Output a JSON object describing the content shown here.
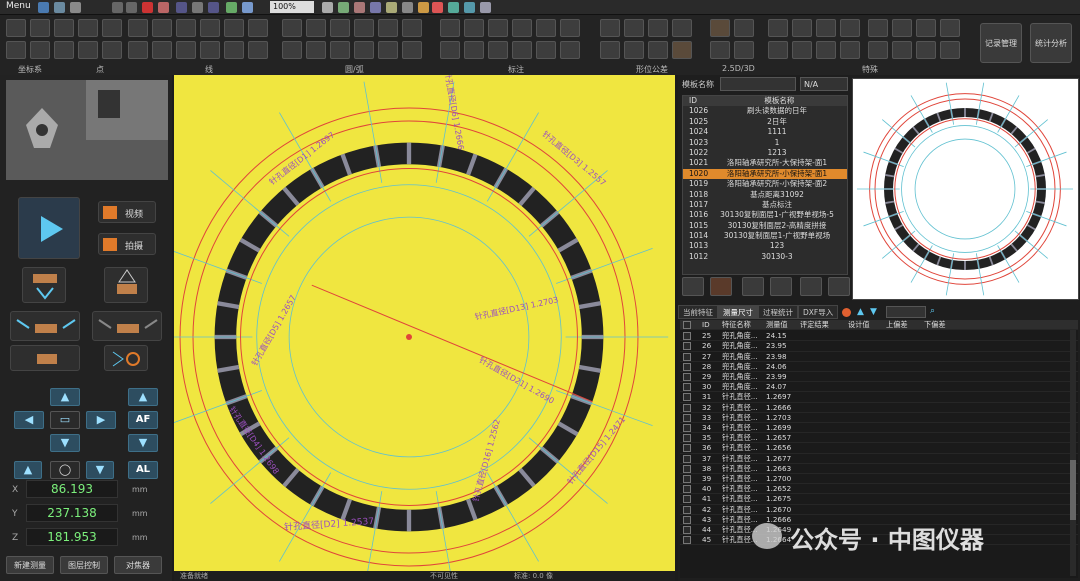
{
  "topbar": {
    "menu_label": "Menu",
    "zoom": "100%"
  },
  "ribbon": {
    "groups": [
      "坐标系",
      "点",
      "线",
      "圆/弧",
      "标注",
      "形位公差",
      "2.5D/3D",
      "特殊"
    ],
    "record_button": "记录管理",
    "stats_button": "统计分析"
  },
  "left": {
    "video_label": "视频",
    "capture_label": "拍摄",
    "af_label": "AF",
    "al_label": "AL",
    "coords": [
      {
        "axis": "X",
        "value": "86.193",
        "unit": "mm"
      },
      {
        "axis": "Y",
        "value": "237.138",
        "unit": "mm"
      },
      {
        "axis": "Z",
        "value": "181.953",
        "unit": "mm"
      }
    ],
    "bottom_buttons": [
      "新建测量",
      "图层控制",
      "对焦器"
    ]
  },
  "status": {
    "left": "准备就绪",
    "mid": "不可见性",
    "right": "标准: 0.0 像"
  },
  "template": {
    "label": "模板名称",
    "select_value": "N/A",
    "columns": [
      "ID",
      "模板名称"
    ],
    "rows": [
      [
        "1026",
        "刷头读数据的日年"
      ],
      [
        "1025",
        "2日年"
      ],
      [
        "1024",
        "1111"
      ],
      [
        "1023",
        "1"
      ],
      [
        "1022",
        "1213"
      ],
      [
        "1021",
        "洛阳轴承研究所-大保持架-面1"
      ],
      [
        "1020",
        "洛阳轴承研究所-小保持架-面1"
      ],
      [
        "1019",
        "洛阳轴承研究所-小保持架-面2"
      ],
      [
        "1018",
        "基点距离31092"
      ],
      [
        "1017",
        "基点标注"
      ],
      [
        "1016",
        "30130复制面层1-广视野单视场-5"
      ],
      [
        "1015",
        "30130复制面层2-高精度拼接"
      ],
      [
        "1014",
        "30130复制面层1-广视野单视场"
      ],
      [
        "1013",
        "123"
      ],
      [
        "1012",
        "30130-3"
      ]
    ],
    "selected_index": 6
  },
  "tabs": [
    "当前特征",
    "测量尺寸",
    "过程统计",
    "DXF导入"
  ],
  "measure": {
    "columns": [
      "ID",
      "特征名称",
      "测量值",
      "评定结果",
      "设计值",
      "上偏差",
      "下偏差"
    ],
    "rows": [
      [
        "25",
        "兜孔角度...",
        "24.15"
      ],
      [
        "26",
        "兜孔角度...",
        "23.95"
      ],
      [
        "27",
        "兜孔角度...",
        "23.98"
      ],
      [
        "28",
        "兜孔角度...",
        "24.06"
      ],
      [
        "29",
        "兜孔角度...",
        "23.99"
      ],
      [
        "30",
        "兜孔角度...",
        "24.07"
      ],
      [
        "31",
        "针孔直径...",
        "1.2697"
      ],
      [
        "32",
        "针孔直径...",
        "1.2666"
      ],
      [
        "33",
        "针孔直径...",
        "1.2703"
      ],
      [
        "34",
        "针孔直径...",
        "1.2699"
      ],
      [
        "35",
        "针孔直径...",
        "1.2657"
      ],
      [
        "36",
        "针孔直径...",
        "1.2656"
      ],
      [
        "37",
        "针孔直径...",
        "1.2677"
      ],
      [
        "38",
        "针孔直径...",
        "1.2663"
      ],
      [
        "39",
        "针孔直径...",
        "1.2700"
      ],
      [
        "40",
        "针孔直径...",
        "1.2652"
      ],
      [
        "41",
        "针孔直径...",
        "1.2675"
      ],
      [
        "42",
        "针孔直径...",
        "1.2670"
      ],
      [
        "43",
        "针孔直径...",
        "1.2666"
      ],
      [
        "44",
        "针孔直径...",
        "1.2649"
      ],
      [
        "45",
        "针孔直径...",
        "1.2664"
      ]
    ]
  },
  "canvas": {
    "annotations": [
      "针孔直径[D1] 1.2697",
      "针孔直径[D2] 1.2537",
      "针孔直径[D3] 1.2557",
      "针孔直径[D4] 1.2698",
      "针孔直径[D5] 1.2657",
      "针孔直径[D6] 1.2666",
      "针孔直径[D13] 1.2703",
      "针孔直径[D15] 1.2471",
      "针孔直径[D16] 1.2562",
      "针孔直径[D21] 1.2690"
    ]
  },
  "watermark": "公众号 · 中图仪器",
  "colors": {
    "canvas_bg": "#f0e640",
    "selected_row": "#e08a2c",
    "accent": "#3e6f88"
  }
}
